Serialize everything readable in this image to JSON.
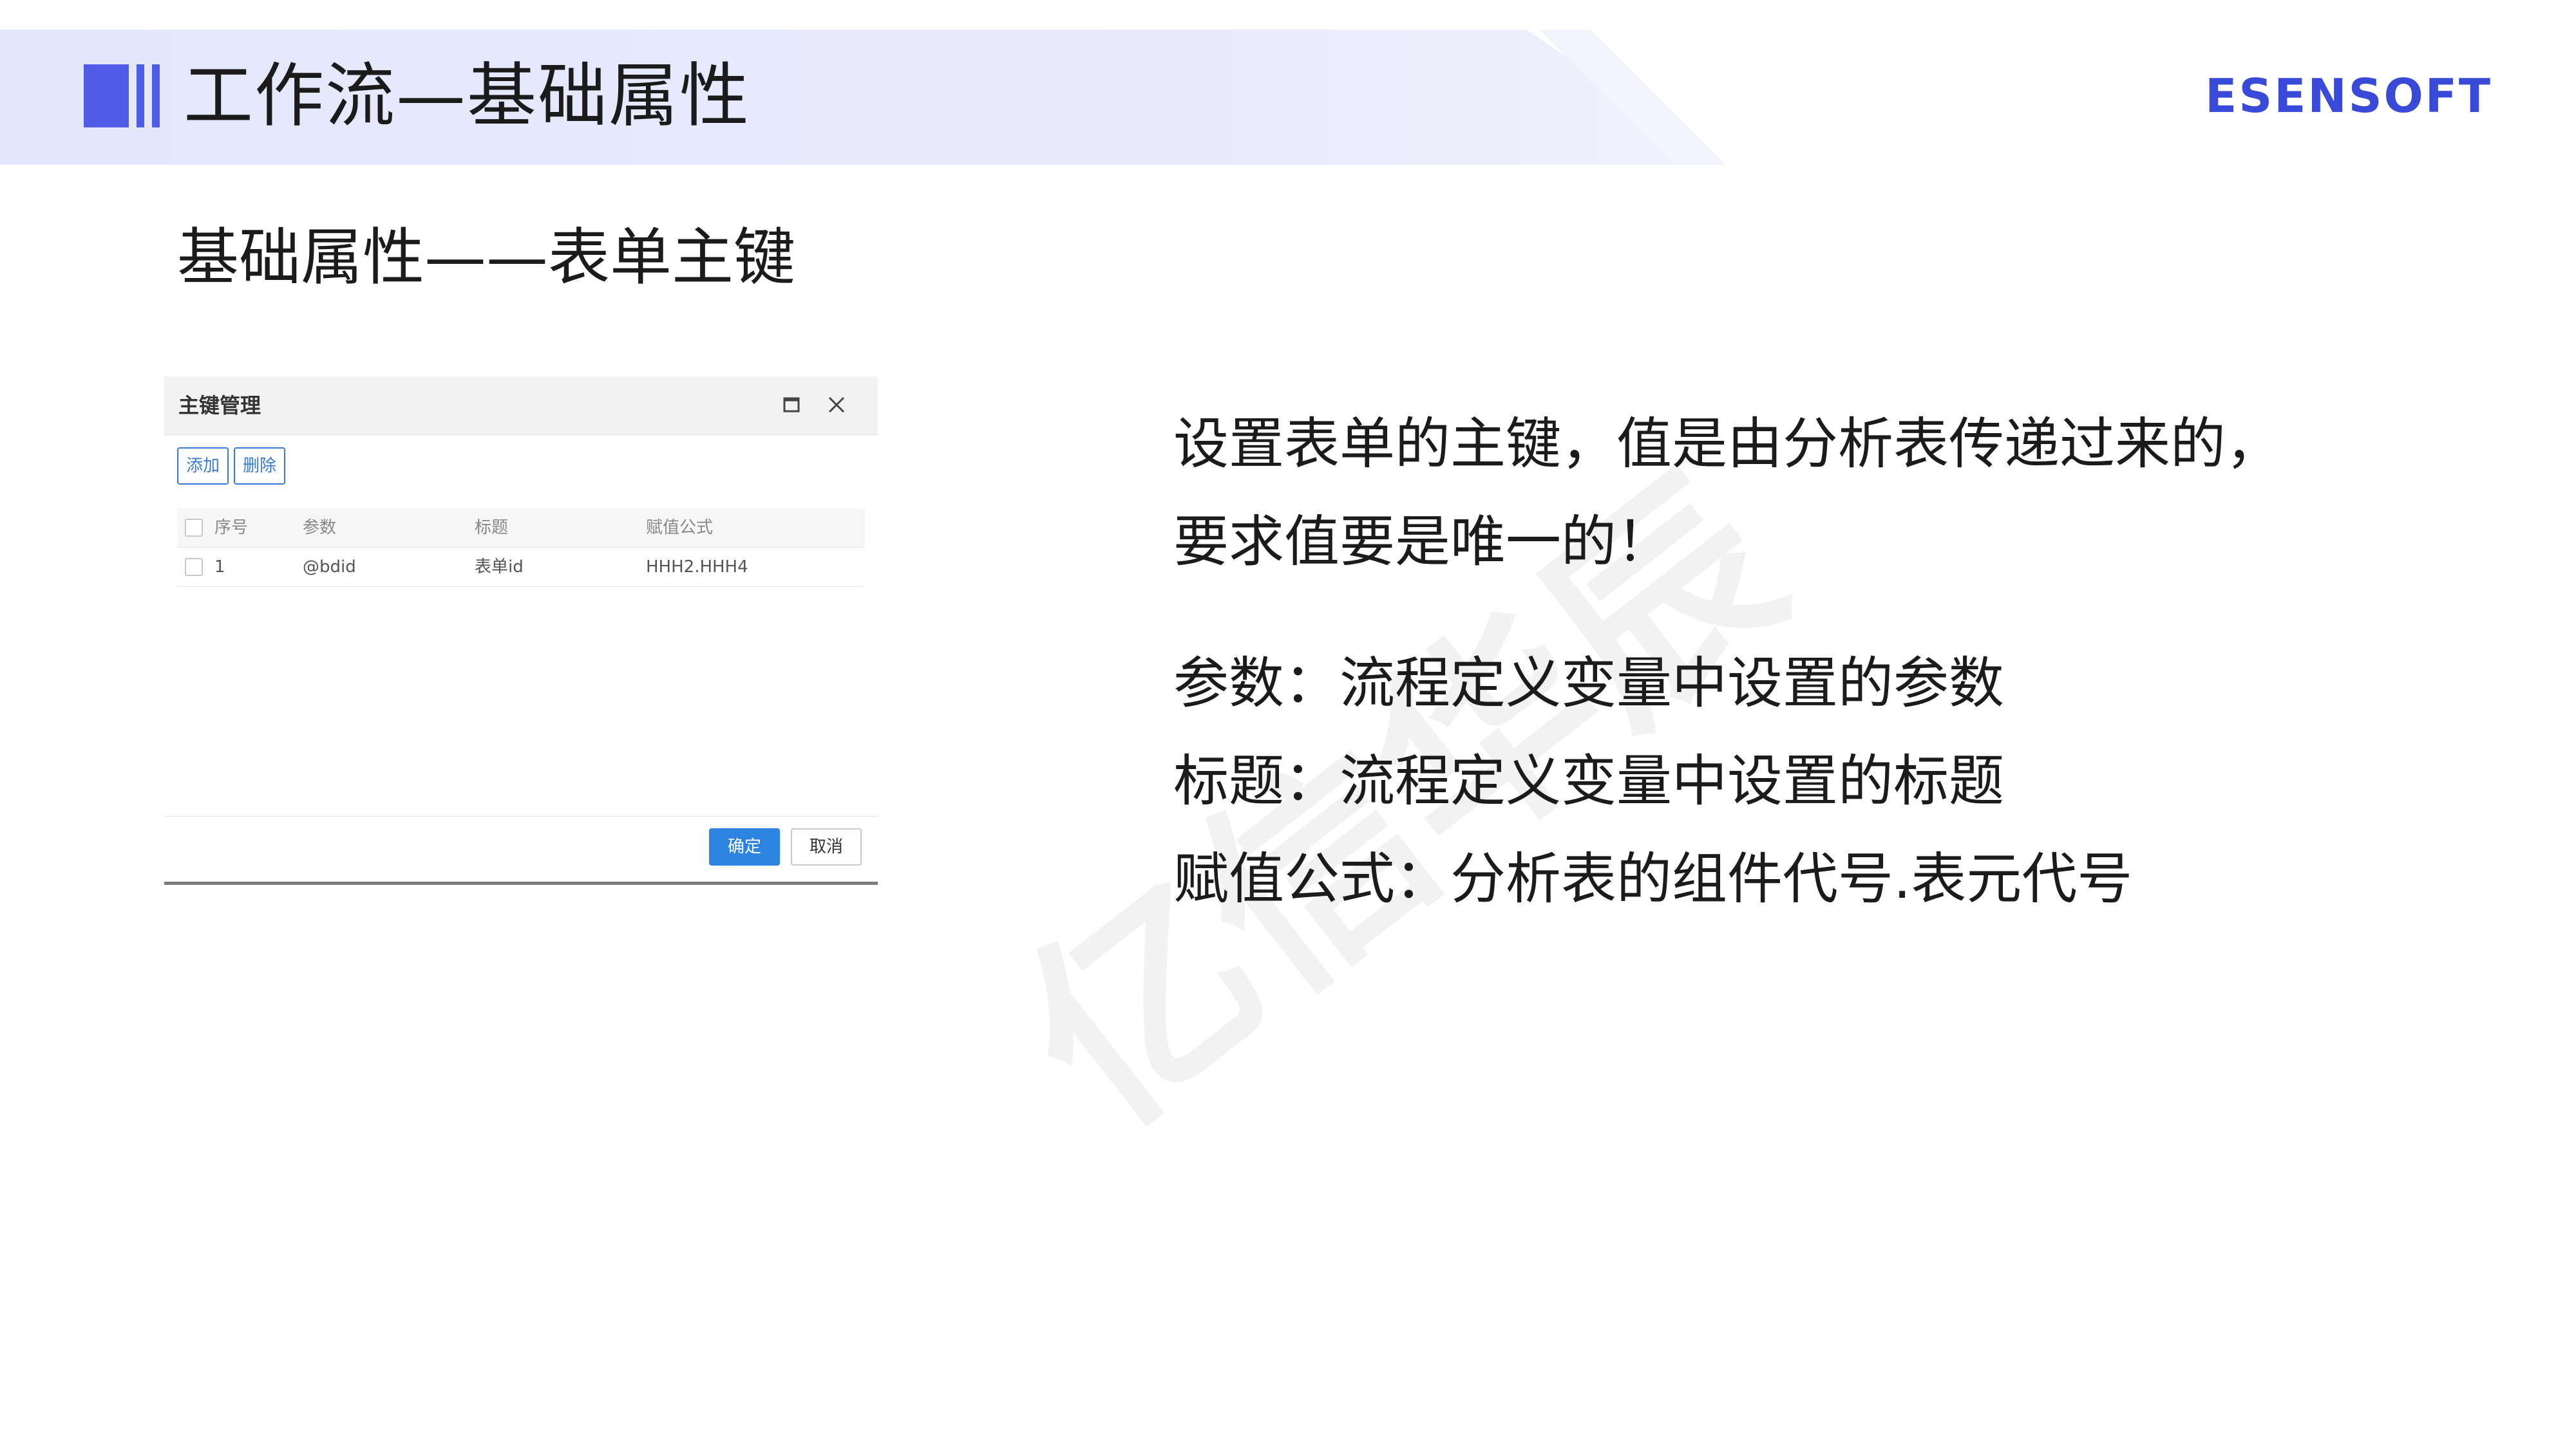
{
  "header": {
    "title": "工作流—基础属性",
    "brand": "ESENSOFT"
  },
  "section_heading": "基础属性——表单主键",
  "watermark": "亿信华辰",
  "dialog": {
    "title": "主键管理",
    "toolbar": {
      "add_label": "添加",
      "delete_label": "删除"
    },
    "columns": [
      "序号",
      "参数",
      "标题",
      "赋值公式"
    ],
    "rows": [
      {
        "index": "1",
        "param": "@bdid",
        "title": "表单id",
        "formula": "HHH2.HHH4"
      }
    ],
    "ok_label": "确定",
    "cancel_label": "取消"
  },
  "description": {
    "line1": "设置表单的主键，值是由分析表传递过来的，",
    "line2": "要求值要是唯一的！",
    "param_line": "参数：流程定义变量中设置的参数",
    "title_line": "标题：流程定义变量中设置的标题",
    "formula_line": "赋值公式：分析表的组件代号.表元代号"
  },
  "colors": {
    "accent": "#4f5de6",
    "brand": "#3a4ad8",
    "primary_button": "#2c83e0"
  }
}
